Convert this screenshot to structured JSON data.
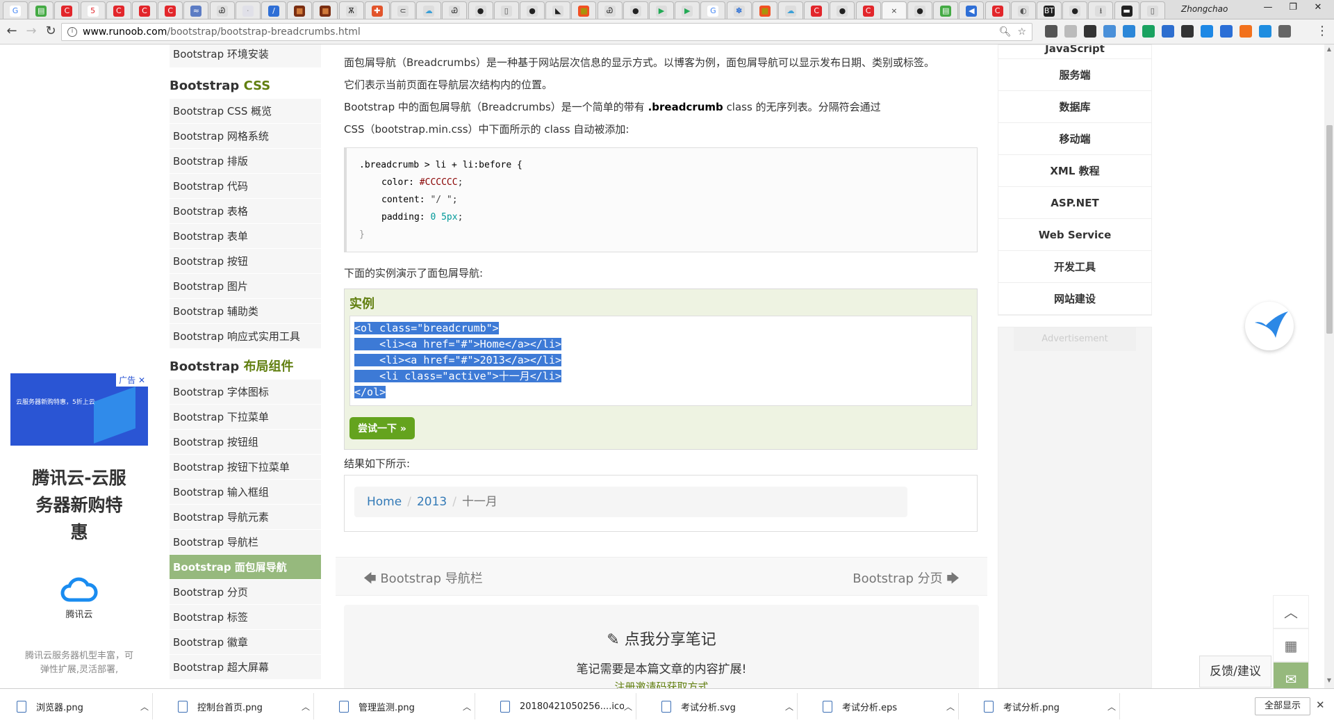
{
  "browser": {
    "user": "Zhongchao",
    "url_domain": "www.runoob.com",
    "url_path": "/bootstrap/bootstrap-breadcrumbs.html",
    "tabs": [
      {
        "color": "#ffffff",
        "glyph": "G",
        "fg": "#4285f4"
      },
      {
        "color": "#44aa44",
        "glyph": "▤",
        "fg": "#fff"
      },
      {
        "color": "#e2262b",
        "glyph": "C",
        "fg": "#fff"
      },
      {
        "color": "#ffffff",
        "glyph": "5",
        "fg": "#e2262b"
      },
      {
        "color": "#e2262b",
        "glyph": "C",
        "fg": "#fff"
      },
      {
        "color": "#e2262b",
        "glyph": "C",
        "fg": "#fff"
      },
      {
        "color": "#e2262b",
        "glyph": "C",
        "fg": "#fff"
      },
      {
        "color": "#5c7cc4",
        "glyph": "≈",
        "fg": "#fff"
      },
      {
        "color": "#dddddd",
        "glyph": "Ꮿ",
        "fg": "#333"
      },
      {
        "color": "#e0e0e8",
        "glyph": "·",
        "fg": "#999"
      },
      {
        "color": "#2f6fd6",
        "glyph": "/",
        "fg": "#fff"
      },
      {
        "color": "#7a2e12",
        "glyph": "■",
        "fg": "#d07a3a"
      },
      {
        "color": "#7a2e12",
        "glyph": "■",
        "fg": "#d07a3a"
      },
      {
        "color": "#dddddd",
        "glyph": "Ѫ",
        "fg": "#333"
      },
      {
        "color": "#e2542b",
        "glyph": "✚",
        "fg": "#fff"
      },
      {
        "color": "#dddddd",
        "glyph": "⊂",
        "fg": "#333"
      },
      {
        "color": "#dddddd",
        "glyph": "☁",
        "fg": "#3aa0d8"
      },
      {
        "color": "#dddddd",
        "glyph": "Ꮿ",
        "fg": "#333"
      },
      {
        "color": "#dddddd",
        "glyph": "●",
        "fg": "#222"
      },
      {
        "color": "#dddddd",
        "glyph": "▯",
        "fg": "#555"
      },
      {
        "color": "#dddddd",
        "glyph": "●",
        "fg": "#222"
      },
      {
        "color": "#dddddd",
        "glyph": "◣",
        "fg": "#222"
      },
      {
        "color": "#f25022",
        "glyph": "▦",
        "fg": "#7fba00"
      },
      {
        "color": "#dddddd",
        "glyph": "Ꮿ",
        "fg": "#333"
      },
      {
        "color": "#dddddd",
        "glyph": "●",
        "fg": "#222"
      },
      {
        "color": "#dddddd",
        "glyph": "▶",
        "fg": "#22aa55"
      },
      {
        "color": "#dddddd",
        "glyph": "▶",
        "fg": "#22aa55"
      },
      {
        "color": "#ffffff",
        "glyph": "G",
        "fg": "#4285f4"
      },
      {
        "color": "#dddddd",
        "glyph": "✽",
        "fg": "#2b6fd6"
      },
      {
        "color": "#f25022",
        "glyph": "▦",
        "fg": "#7fba00"
      },
      {
        "color": "#dddddd",
        "glyph": "☁",
        "fg": "#3aa0d8"
      },
      {
        "color": "#e2262b",
        "glyph": "C",
        "fg": "#fff"
      },
      {
        "color": "#dddddd",
        "glyph": "●",
        "fg": "#222"
      },
      {
        "color": "#e2262b",
        "glyph": "C",
        "fg": "#fff"
      },
      {
        "color": "#f6f6f6",
        "glyph": "×",
        "fg": "#444",
        "active": true
      },
      {
        "color": "#dddddd",
        "glyph": "●",
        "fg": "#222"
      },
      {
        "color": "#44aa44",
        "glyph": "▤",
        "fg": "#fff"
      },
      {
        "color": "#2f6fd6",
        "glyph": "◀",
        "fg": "#fff"
      },
      {
        "color": "#e2262b",
        "glyph": "C",
        "fg": "#fff"
      },
      {
        "color": "#dddddd",
        "glyph": "◐",
        "fg": "#555"
      },
      {
        "color": "#222222",
        "glyph": "BT",
        "fg": "#fff"
      },
      {
        "color": "#dddddd",
        "glyph": "●",
        "fg": "#222"
      },
      {
        "color": "#dddddd",
        "glyph": "⭳",
        "fg": "#444"
      },
      {
        "color": "#222222",
        "glyph": "▬",
        "fg": "#fff"
      },
      {
        "color": "#dddddd",
        "glyph": "▯",
        "fg": "#555"
      }
    ],
    "ext_colors": [
      "#555555",
      "#bbbbbb",
      "#333333",
      "#4a90d9",
      "#2c87d8",
      "#1aa260",
      "#2d6ecf",
      "#333333",
      "#1e88e5",
      "#2b6fd6",
      "#f2711c",
      "#1f8de0",
      "#666666"
    ]
  },
  "sidebar": {
    "top_item": "Bootstrap 环境安装",
    "section_css": {
      "prefix": "Bootstrap ",
      "highlight": "CSS"
    },
    "css_items": [
      "Bootstrap CSS 概览",
      "Bootstrap 网格系统",
      "Bootstrap 排版",
      "Bootstrap 代码",
      "Bootstrap 表格",
      "Bootstrap 表单",
      "Bootstrap 按钮",
      "Bootstrap 图片",
      "Bootstrap 辅助类",
      "Bootstrap 响应式实用工具"
    ],
    "section_layout": {
      "prefix": "Bootstrap ",
      "highlight": "布局组件"
    },
    "layout_items": [
      "Bootstrap 字体图标",
      "Bootstrap 下拉菜单",
      "Bootstrap 按钮组",
      "Bootstrap 按钮下拉菜单",
      "Bootstrap 输入框组",
      "Bootstrap 导航元素",
      "Bootstrap 导航栏",
      "Bootstrap 面包屑导航",
      "Bootstrap 分页",
      "Bootstrap 标签",
      "Bootstrap 徽章",
      "Bootstrap 超大屏幕"
    ],
    "active_item": "Bootstrap 面包屑导航"
  },
  "content": {
    "p1": "面包屑导航（Breadcrumbs）是一种基于网站层次信息的显示方式。以博客为例，面包屑导航可以显示发布日期、类别或标签。",
    "p2": "它们表示当前页面在导航层次结构内的位置。",
    "p3a": "Bootstrap 中的面包屑导航（Breadcrumbs）是一个简单的带有 ",
    "p3b": ".breadcrumb",
    "p3c": " class 的无序列表。分隔符会通过",
    "p4": "CSS（bootstrap.min.css）中下面所示的 class 自动被添加:",
    "css_code": {
      "selector": ".breadcrumb > li + li:before {",
      "l1_prop": "color: ",
      "l1_val": "#CCCCCC",
      "l1_end": ";",
      "l2_prop": "content: ",
      "l2_val": "\"/ \"",
      "l2_end": ";",
      "l3_prop": "padding: ",
      "l3_val": "0 5px",
      "l3_end": ";",
      "close": "}"
    },
    "p5": "下面的实例演示了面包屑导航:",
    "example_title": "实例",
    "example_lines": [
      "<ol class=\"breadcrumb\">",
      "    <li><a href=\"#\">Home</a></li>",
      "    <li><a href=\"#\">2013</a></li>",
      "    <li class=\"active\">十一月</li>",
      "</ol>"
    ],
    "try_button": "尝试一下 »",
    "p6": "结果如下所示:",
    "breadcrumb": {
      "home": "Home",
      "year": "2013",
      "current": "十一月",
      "sep": "/"
    },
    "prev_label": "Bootstrap 导航栏",
    "next_label": "Bootstrap 分页",
    "note_title": "点我分享笔记",
    "note_sub": "笔记需要是本篇文章的内容扩展!",
    "note_link": "注册邀请码获取方式"
  },
  "right": {
    "nav_items": [
      "JavaScript",
      "服务端",
      "数据库",
      "移动端",
      "XML 教程",
      "ASP.NET",
      "Web Service",
      "开发工具",
      "网站建设"
    ],
    "ad_label": "Advertisement",
    "ad_tag": "广告",
    "ad_banner_title": "云服务器新购特惠，5折上云",
    "ad_big": "腾讯云-云服务器新购特惠",
    "ad_brand": "腾讯云",
    "ad_desc": "腾讯云服务器机型丰富，可弹性扩展,灵活部署,",
    "feedback": "反馈/建议"
  },
  "downloads": {
    "items": [
      "浏览器.png",
      "控制台首页.png",
      "管理监测.png",
      "20180421050256....ico",
      "考试分析.svg",
      "考试分析.eps",
      "考试分析.png"
    ],
    "show_all": "全部显示"
  }
}
